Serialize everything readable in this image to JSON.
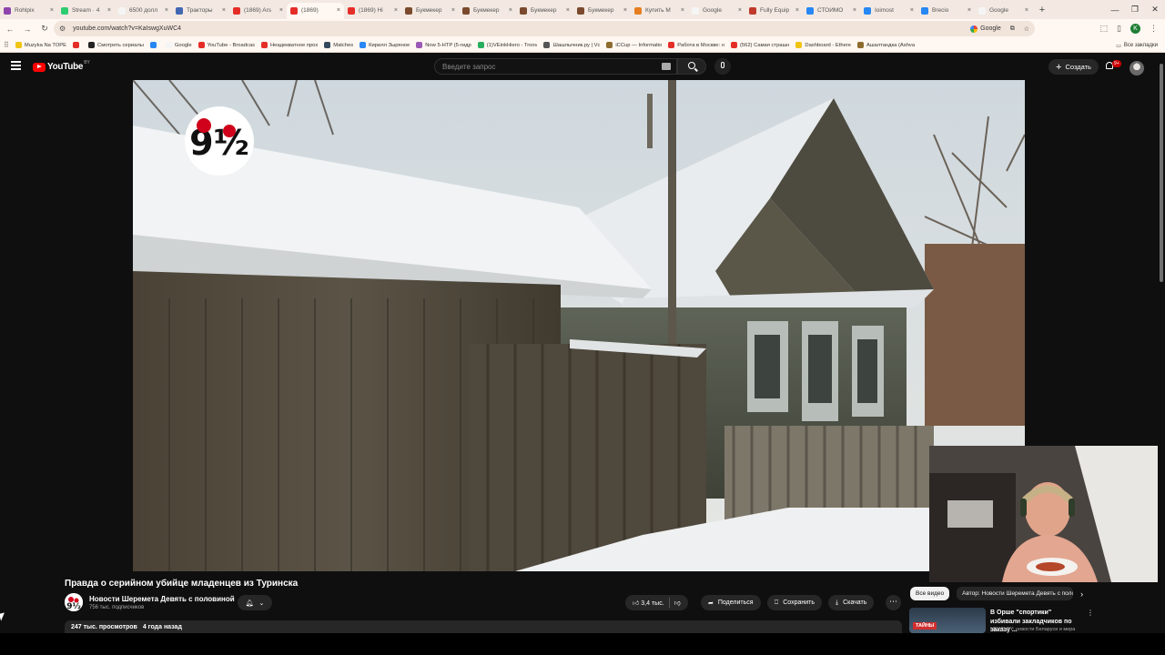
{
  "browser": {
    "tabs": [
      {
        "label": "Rohlpix",
        "color": "#8e44ad"
      },
      {
        "label": "Stream · 4",
        "color": "#2ecc71"
      },
      {
        "label": "6500 долл",
        "color": "#f5f5f5"
      },
      {
        "label": "Тракторы",
        "color": "#4267b2"
      },
      {
        "label": "(1869) Ars",
        "color": "#e52d27"
      },
      {
        "label": "(1869)",
        "color": "#e52d27",
        "active": true
      },
      {
        "label": "(1869) Hi",
        "color": "#e52d27"
      },
      {
        "label": "Букмекер",
        "color": "#7b4a2e"
      },
      {
        "label": "Букмекер",
        "color": "#7b4a2e"
      },
      {
        "label": "Букмекер",
        "color": "#7b4a2e"
      },
      {
        "label": "Букмекер",
        "color": "#7b4a2e"
      },
      {
        "label": "Купить М",
        "color": "#e67e22"
      },
      {
        "label": "Google",
        "color": "#f5f5f5"
      },
      {
        "label": "Fully Equip",
        "color": "#c0392b"
      },
      {
        "label": "СТОИМО",
        "color": "#2787f5"
      },
      {
        "label": "Ioimost",
        "color": "#2787f5"
      },
      {
        "label": "Brecio",
        "color": "#2787f5"
      },
      {
        "label": "Google",
        "color": "#f5f5f5"
      }
    ],
    "url": "youtube.com/watch?v=KaIswgXuWC4",
    "search_engine": "Google",
    "profile_initial": "K",
    "bookmarks": [
      {
        "label": "Muzyka Na TOPE",
        "color": "#f1c40f"
      },
      {
        "label": "",
        "color": "#e52d27"
      },
      {
        "label": "Смотреть сериалы",
        "color": "#222222"
      },
      {
        "label": "",
        "color": "#2787f5"
      },
      {
        "label": "Google",
        "color": "#f5f5f5"
      },
      {
        "label": "YouTube - Broadcas",
        "color": "#e52d27"
      },
      {
        "label": "Неадекватное прох",
        "color": "#e52d27"
      },
      {
        "label": "Matches",
        "color": "#34495e"
      },
      {
        "label": "Кирилл Зыряное",
        "color": "#2787f5"
      },
      {
        "label": "Now 5-HTP (5-гидр",
        "color": "#9b59b6"
      },
      {
        "label": "(1)VEinkHiero - Troov",
        "color": "#27ae60"
      },
      {
        "label": "Шашлычник.ру | Vc",
        "color": "#555555"
      },
      {
        "label": "iCCup — Informatio",
        "color": "#8e6b2e"
      },
      {
        "label": "Работа в Москве: н",
        "color": "#e52d27"
      },
      {
        "label": "(562) Самая страшн",
        "color": "#e52d27"
      },
      {
        "label": "Dashboard - Ethere",
        "color": "#f1c40f"
      },
      {
        "label": "Ашалтандка (Ashva",
        "color": "#8e6b2e"
      }
    ],
    "all_bookmarks": "Все закладки"
  },
  "youtube": {
    "logo_text": "YouTube",
    "country": "BY",
    "search_placeholder": "Введите запрос",
    "create_label": "Создать",
    "notifications_badge": "9+"
  },
  "video": {
    "title": "Правда о серийном убийце младенцев из Туринска",
    "channel_name": "Новости Шеремета Девять с половиной",
    "subscribers": "756 тыс. подписчиков",
    "likes": "3,4 тыс.",
    "share_label": "Поделиться",
    "save_label": "Сохранить",
    "download_label": "Скачать",
    "views": "247 тыс. просмотров",
    "published": "4 года назад",
    "logo_text": "9½"
  },
  "sidebar": {
    "chips": [
      "Все видео",
      "Автор: Новости Шеремета Девять с половиной"
    ],
    "recommended": {
      "title": "В Орше \"спортики\" избивали закладчиков по заказу ...",
      "channel": "NEWS.BY: новости Беларуси и мира",
      "thumb_tag": "ТАЙНЫ"
    }
  }
}
